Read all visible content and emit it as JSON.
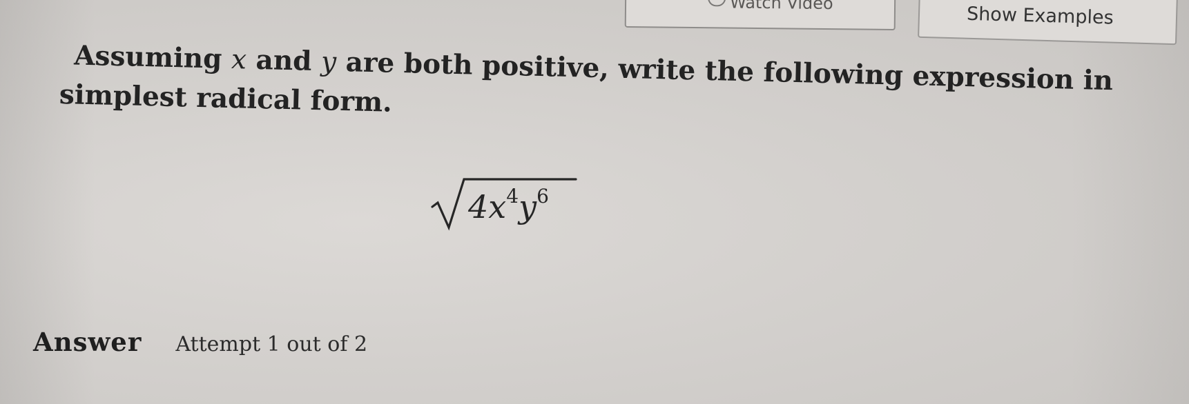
{
  "toolbar": {
    "watch_video_label": "Watch Video",
    "show_examples_label": "Show Examples"
  },
  "question": {
    "line1_pre": "Assuming ",
    "var_x": "x",
    "and": " and ",
    "var_y": "y",
    "line1_post": " are both positive, write the following expression in",
    "line2": "simplest radical form."
  },
  "expression": {
    "coefficient": "4",
    "var_x": "x",
    "exp_x": "4",
    "var_y": "y",
    "exp_y": "6"
  },
  "answer": {
    "label": "Answer",
    "attempt": "Attempt 1 out of 2"
  }
}
